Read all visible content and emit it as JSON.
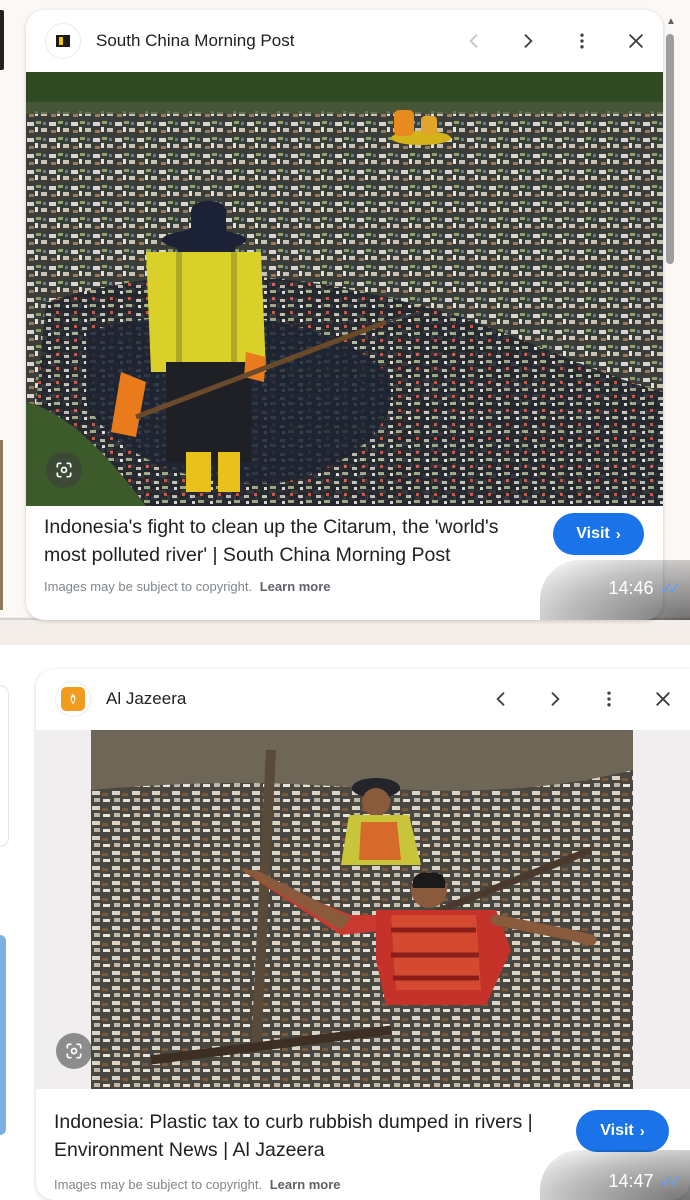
{
  "cards": [
    {
      "site_name": "South China Morning Post",
      "caption": "Indonesia's fight to clean up the Citarum, the 'world's most polluted river' | South China Morning Post",
      "copyright_text": "Images may be subject to copyright.",
      "learn_more": "Learn more",
      "visit_label": "Visit",
      "timestamp": "14:46",
      "favicon": "scmp-logo-icon",
      "photo": "river-cleanup-worker-photo"
    },
    {
      "site_name": "Al Jazeera",
      "caption": "Indonesia: Plastic tax to curb rubbish dumped in rivers | Environment News | Al Jazeera",
      "copyright_text": "Images may be subject to copyright.",
      "learn_more": "Learn more",
      "visit_label": "Visit",
      "timestamp": "14:47",
      "favicon": "al-jazeera-logo-icon",
      "photo": "men-wading-in-trash-river-photo"
    }
  ],
  "icons": {
    "prev": "chevron-left-icon",
    "next": "chevron-right-icon",
    "more": "more-vert-icon",
    "close": "close-icon",
    "lens": "google-lens-icon",
    "read_receipt": "double-check-icon"
  },
  "colors": {
    "visit_button": "#1a73e8",
    "read_ticks": "#5ba0ff",
    "aj_orange": "#f29c1f"
  }
}
